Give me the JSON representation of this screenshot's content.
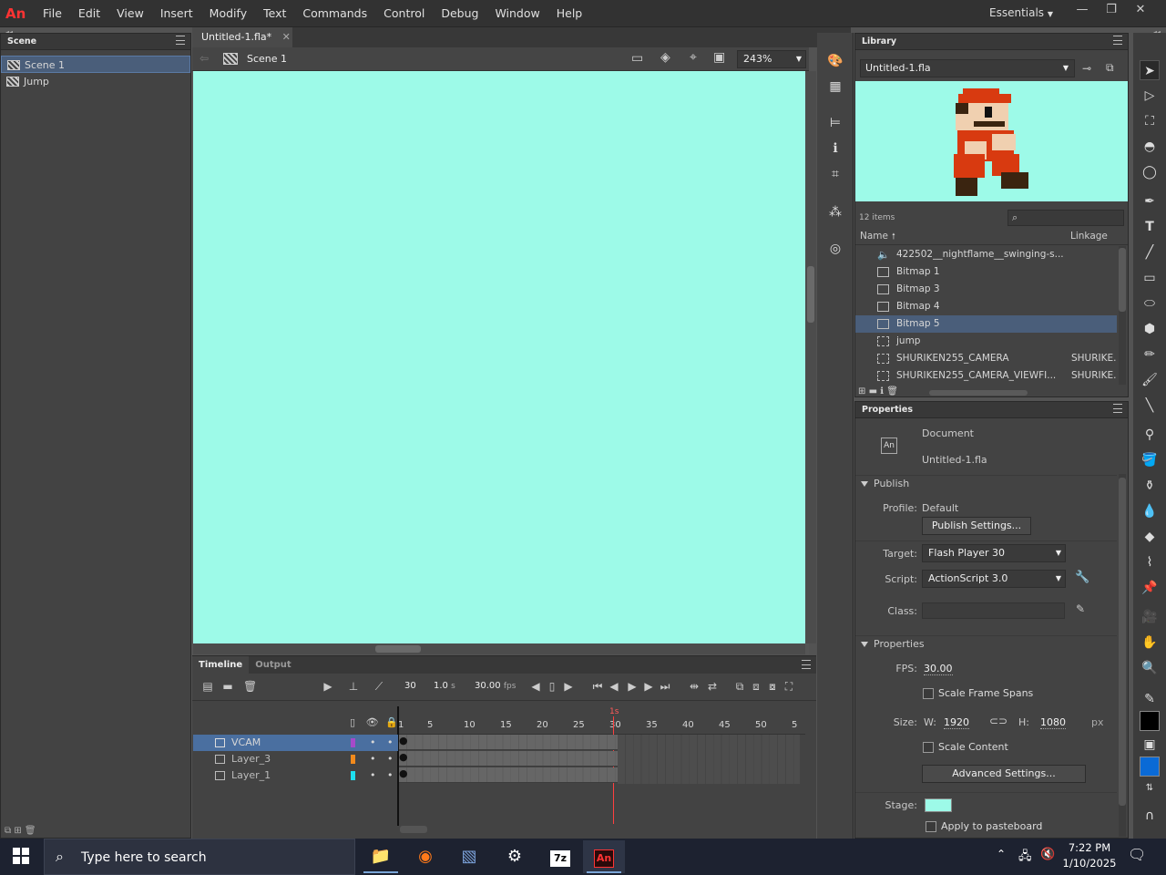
{
  "menubar": {
    "app_logo": "An",
    "items": [
      "File",
      "Edit",
      "View",
      "Insert",
      "Modify",
      "Text",
      "Commands",
      "Control",
      "Debug",
      "Window",
      "Help"
    ],
    "workspace": "Essentials"
  },
  "scene_panel": {
    "title": "Scene",
    "scenes": [
      "Scene 1",
      "Jump"
    ]
  },
  "document": {
    "tab_label": "Untitled-1.fla*",
    "scene_label": "Scene 1",
    "zoom": "243%",
    "stage_color": "#9dfae8"
  },
  "timeline": {
    "tabs": [
      "Timeline",
      "Output"
    ],
    "current_frame": "30",
    "current_time": "1.0",
    "time_unit": "s",
    "fps": "30.00",
    "fps_unit": "fps",
    "ruler": [
      "1",
      "5",
      "10",
      "15",
      "20",
      "25",
      "30",
      "35",
      "40",
      "45",
      "50",
      "5"
    ],
    "playhead_label": "1s",
    "layers": [
      {
        "name": "VCAM",
        "color": "#a64ac9"
      },
      {
        "name": "Layer_3",
        "color": "#f28a1c"
      },
      {
        "name": "Layer_1",
        "color": "#1ee0f0"
      }
    ]
  },
  "library": {
    "title": "Library",
    "file": "Untitled-1.fla",
    "item_count": "12 items",
    "col_name": "Name",
    "col_linkage": "Linkage",
    "items": [
      {
        "name": "422502__nightflame__swinging-s...",
        "linkage": ""
      },
      {
        "name": "Bitmap 1",
        "linkage": ""
      },
      {
        "name": "Bitmap 3",
        "linkage": ""
      },
      {
        "name": "Bitmap 4",
        "linkage": ""
      },
      {
        "name": "Bitmap 5",
        "linkage": ""
      },
      {
        "name": "jump",
        "linkage": ""
      },
      {
        "name": "SHURIKEN255_CAMERA",
        "linkage": "SHURIKE."
      },
      {
        "name": "SHURIKEN255_CAMERA_VIEWFI...",
        "linkage": "SHURIKE."
      }
    ]
  },
  "properties": {
    "title": "Properties",
    "doc_type": "Document",
    "doc_icon": "An",
    "doc_name": "Untitled-1.fla",
    "publish_section": "Publish",
    "profile_label": "Profile:",
    "profile_value": "Default",
    "publish_settings_btn": "Publish Settings...",
    "target_label": "Target:",
    "target_value": "Flash Player 30",
    "script_label": "Script:",
    "script_value": "ActionScript 3.0",
    "class_label": "Class:",
    "properties_section": "Properties",
    "fps_label": "FPS:",
    "fps_value": "30.00",
    "scale_frame_spans": "Scale Frame Spans",
    "size_label": "Size:",
    "w_label": "W:",
    "w_value": "1920",
    "h_label": "H:",
    "h_value": "1080",
    "unit": "px",
    "scale_content": "Scale Content",
    "advanced_btn": "Advanced Settings...",
    "stage_label": "Stage:",
    "stage_swatch": "#9dfae8",
    "apply_pasteboard": "Apply to pasteboard"
  },
  "taskbar": {
    "search_placeholder": "Type here to search",
    "time": "7:22 PM",
    "date": "1/10/2025"
  }
}
